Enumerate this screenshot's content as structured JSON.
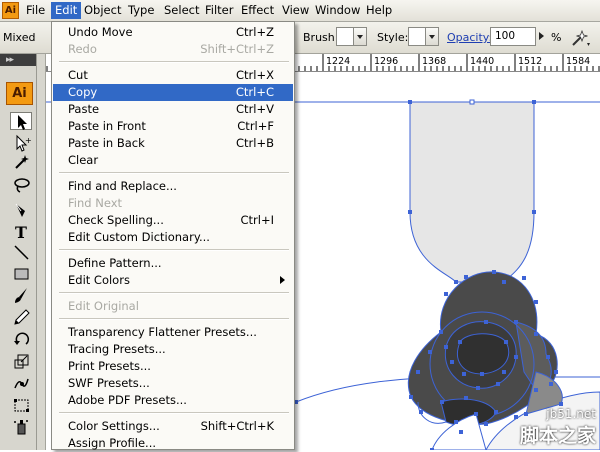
{
  "app": {
    "logo_text": "Ai"
  },
  "menubar": {
    "items": [
      "File",
      "Edit",
      "Object",
      "Type",
      "Select",
      "Filter",
      "Effect",
      "View",
      "Window",
      "Help"
    ],
    "active": "Edit"
  },
  "controlbar": {
    "mixed_label": "Mixed",
    "brush_label": "Brush:",
    "style_label": "Style:",
    "opacity_label": "Opacity:",
    "opacity_value": "100",
    "percent_label": "%"
  },
  "ruler": {
    "ticks": [
      "1224",
      "1296",
      "1368",
      "1440",
      "1512",
      "1584"
    ]
  },
  "edit_menu": {
    "groups": [
      [
        {
          "label": "Undo Move",
          "shortcut": "Ctrl+Z"
        },
        {
          "label": "Redo",
          "shortcut": "Shift+Ctrl+Z",
          "disabled": true
        }
      ],
      [
        {
          "label": "Cut",
          "shortcut": "Ctrl+X"
        },
        {
          "label": "Copy",
          "shortcut": "Ctrl+C",
          "hover": true
        },
        {
          "label": "Paste",
          "shortcut": "Ctrl+V"
        },
        {
          "label": "Paste in Front",
          "shortcut": "Ctrl+F"
        },
        {
          "label": "Paste in Back",
          "shortcut": "Ctrl+B"
        },
        {
          "label": "Clear",
          "shortcut": ""
        }
      ],
      [
        {
          "label": "Find and Replace...",
          "shortcut": ""
        },
        {
          "label": "Find Next",
          "shortcut": "",
          "disabled": true
        },
        {
          "label": "Check Spelling...",
          "shortcut": "Ctrl+I"
        },
        {
          "label": "Edit Custom Dictionary...",
          "shortcut": ""
        }
      ],
      [
        {
          "label": "Define Pattern...",
          "shortcut": ""
        },
        {
          "label": "Edit Colors",
          "shortcut": "",
          "submenu": true
        }
      ],
      [
        {
          "label": "Edit Original",
          "shortcut": "",
          "disabled": true
        }
      ],
      [
        {
          "label": "Transparency Flattener Presets...",
          "shortcut": ""
        },
        {
          "label": "Tracing Presets...",
          "shortcut": ""
        },
        {
          "label": "Print Presets...",
          "shortcut": ""
        },
        {
          "label": "SWF Presets...",
          "shortcut": ""
        },
        {
          "label": "Adobe PDF Presets...",
          "shortcut": ""
        }
      ],
      [
        {
          "label": "Color Settings...",
          "shortcut": "Shift+Ctrl+K"
        },
        {
          "label": "Assign Profile...",
          "shortcut": ""
        }
      ]
    ]
  },
  "tools": [
    {
      "name": "selection-tool-icon",
      "selected": true
    },
    {
      "name": "direct-selection-tool-icon"
    },
    {
      "name": "magic-wand-tool-icon"
    },
    {
      "name": "lasso-tool-icon"
    },
    {
      "name": "pen-tool-icon"
    },
    {
      "name": "type-tool-icon"
    },
    {
      "name": "line-segment-tool-icon"
    },
    {
      "name": "rectangle-tool-icon"
    },
    {
      "name": "paintbrush-tool-icon"
    },
    {
      "name": "pencil-tool-icon"
    },
    {
      "name": "rotate-tool-icon"
    },
    {
      "name": "scale-tool-icon"
    },
    {
      "name": "warp-tool-icon"
    },
    {
      "name": "free-transform-tool-icon"
    },
    {
      "name": "symbol-sprayer-tool-icon"
    }
  ],
  "colors": {
    "menu_highlight": "#3169c6",
    "selection_blue": "#3d63d6",
    "artwork_dark": "#4a4a4a",
    "artwork_light": "#e6e6e6"
  },
  "watermark": {
    "url": "jb51.net",
    "text": "脚本之家"
  }
}
